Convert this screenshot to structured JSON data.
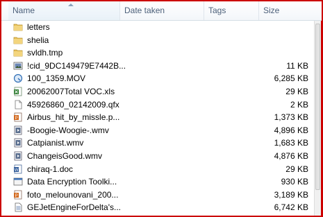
{
  "columns": {
    "name": "Name",
    "date_taken": "Date taken",
    "tags": "Tags",
    "size": "Size"
  },
  "colors": {
    "folder": "#e8c15a",
    "border_highlight": "#cc0000",
    "header_text": "#4c607a"
  },
  "files": [
    {
      "name": "letters",
      "size": "",
      "icon": "folder-icon"
    },
    {
      "name": "shelia",
      "size": "",
      "icon": "folder-icon"
    },
    {
      "name": "svldh.tmp",
      "size": "",
      "icon": "folder-icon"
    },
    {
      "name": "!cid_9DC149479E7442B...",
      "size": "11 KB",
      "icon": "image-file-icon"
    },
    {
      "name": "100_1359.MOV",
      "size": "6,285 KB",
      "icon": "quicktime-file-icon"
    },
    {
      "name": "20062007Total VOC.xls",
      "size": "29 KB",
      "icon": "excel-file-icon"
    },
    {
      "name": "45926860_02142009.qfx",
      "size": "2 KB",
      "icon": "generic-file-icon"
    },
    {
      "name": "Airbus_hit_by_missle.p...",
      "size": "1,373 KB",
      "icon": "powerpoint-file-icon"
    },
    {
      "name": "-Boogie-Woogie-.wmv",
      "size": "4,896 KB",
      "icon": "video-file-icon"
    },
    {
      "name": "Catpianist.wmv",
      "size": "1,683 KB",
      "icon": "video-file-icon"
    },
    {
      "name": "ChangeisGood.wmv",
      "size": "4,876 KB",
      "icon": "video-file-icon"
    },
    {
      "name": "chiraq-1.doc",
      "size": "29 KB",
      "icon": "word-file-icon"
    },
    {
      "name": "Data Encryption Toolki...",
      "size": "930 KB",
      "icon": "executable-file-icon"
    },
    {
      "name": "foto_melounovani_200...",
      "size": "3,189 KB",
      "icon": "powerpoint-file-icon"
    },
    {
      "name": "GEJetEngineForDelta's...",
      "size": "6,742 KB",
      "icon": "document-file-icon"
    }
  ]
}
